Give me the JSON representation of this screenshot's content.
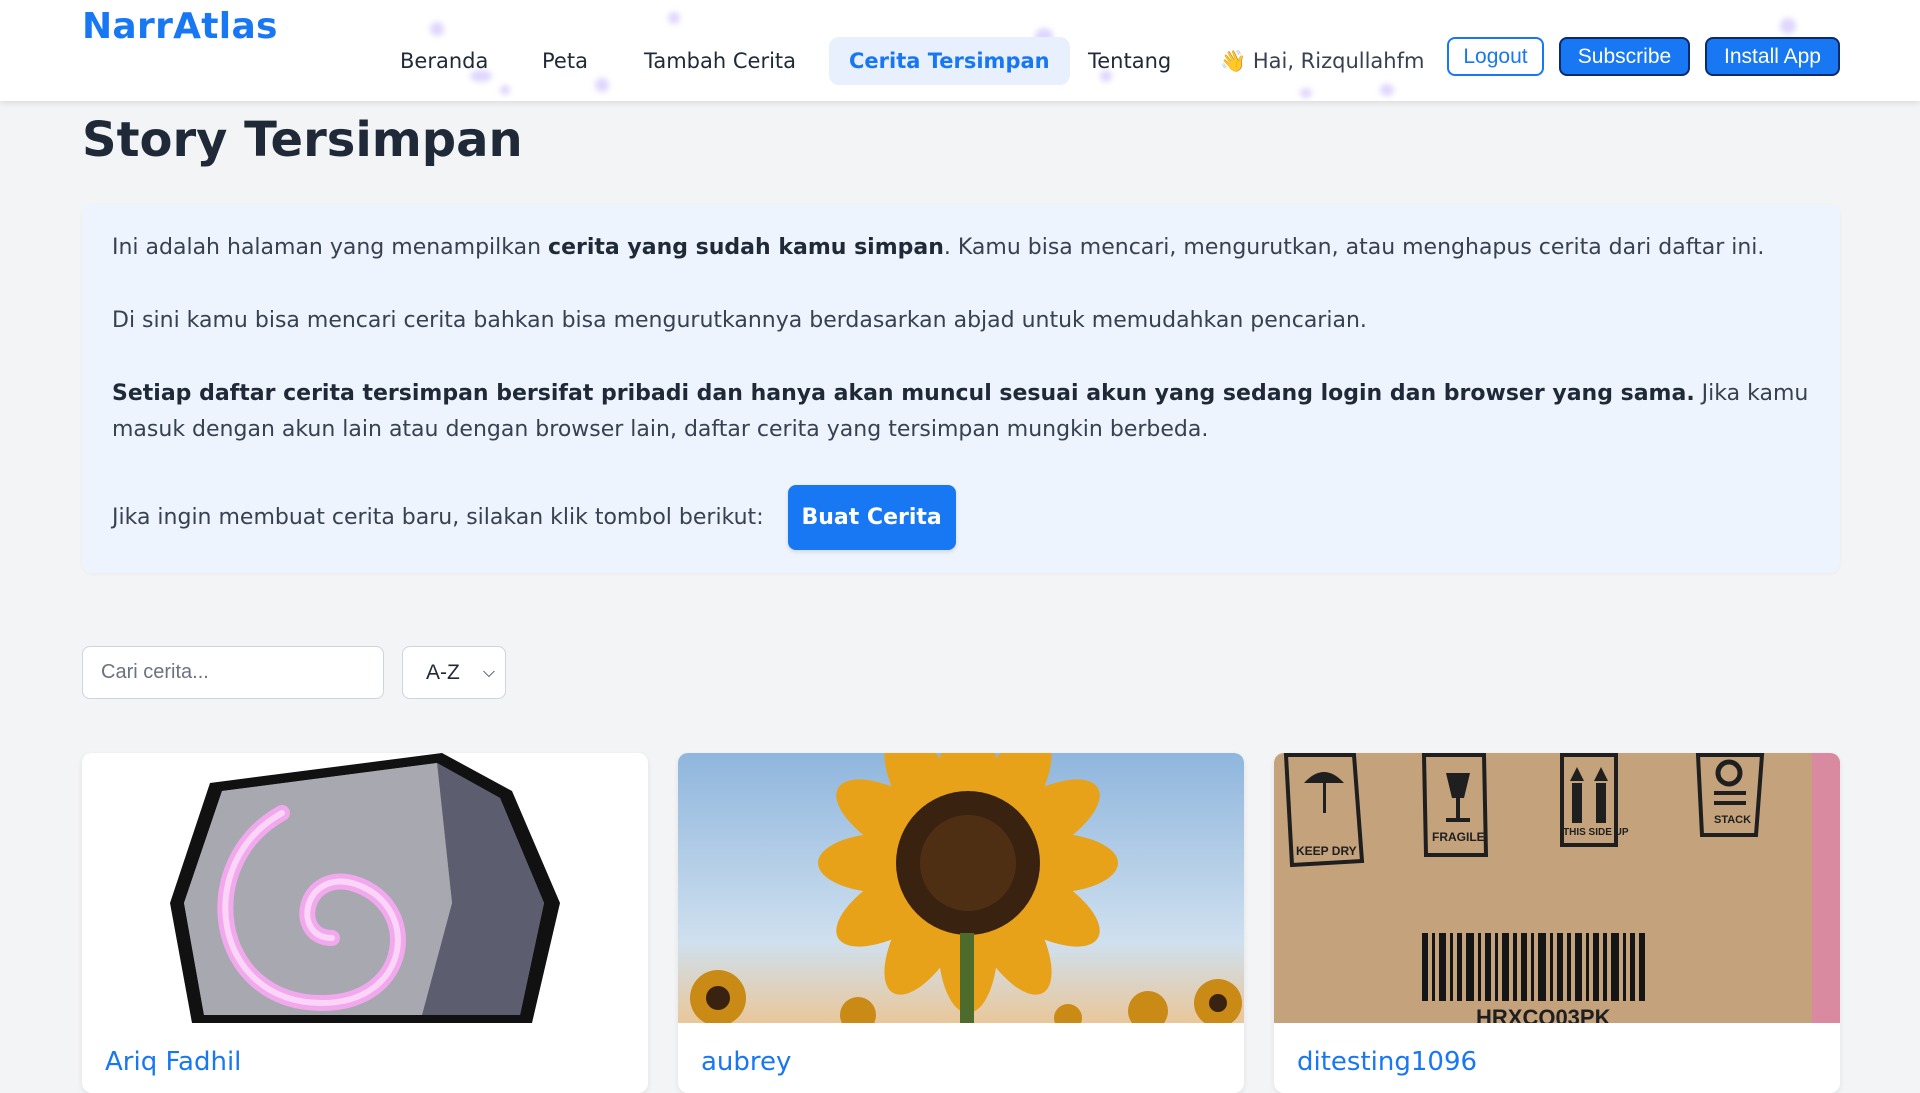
{
  "header": {
    "brand": "NarrAtlas",
    "nav": [
      "Beranda",
      "Peta",
      "Tambah Cerita",
      "Cerita Tersimpan",
      "Tentang"
    ],
    "active_nav": "Cerita Tersimpan",
    "greeting": "👋 Hai, Rizqullahfm",
    "logout": "Logout",
    "subscribe": "Subscribe",
    "install": "Install App"
  },
  "page": {
    "title": "Story Tersimpan",
    "intro_a": "Ini adalah halaman yang menampilkan ",
    "intro_bold": "cerita yang sudah kamu simpan",
    "intro_b": ". Kamu bisa mencari, mengurutkan, atau menghapus cerita dari daftar ini.",
    "search_info": "Di sini kamu bisa mencari cerita bahkan bisa mengurutkannya berdasarkan abjad untuk memudahkan pencarian.",
    "privacy_bold": "Setiap daftar cerita tersimpan bersifat pribadi dan hanya akan muncul sesuai akun yang sedang login dan browser yang sama.",
    "privacy_rest": " Jika kamu masuk dengan akun lain atau dengan browser lain, daftar cerita yang tersimpan mungkin berbeda.",
    "cta_text": "Jika ingin membuat cerita baru, silakan klik tombol berikut:",
    "cta_button": "Buat Cerita"
  },
  "filters": {
    "search_placeholder": "Cari cerita...",
    "sort_value": "A-Z"
  },
  "cards": [
    {
      "title": "Ariq Fadhil",
      "image": "swirl-stone-icon"
    },
    {
      "title": "aubrey",
      "image": "sunflower-photo"
    },
    {
      "title": "ditesting1096",
      "image": "cardboard-box-photo",
      "box_symbols": [
        "KEEP DRY",
        "FRAGILE",
        "THIS SIDE UP",
        "STACK"
      ],
      "barcode_text": "HRXCQ03PK"
    }
  ],
  "colors": {
    "accent": "#1877f2",
    "info_bg": "#eef4fd",
    "page_bg": "#f3f4f6"
  }
}
